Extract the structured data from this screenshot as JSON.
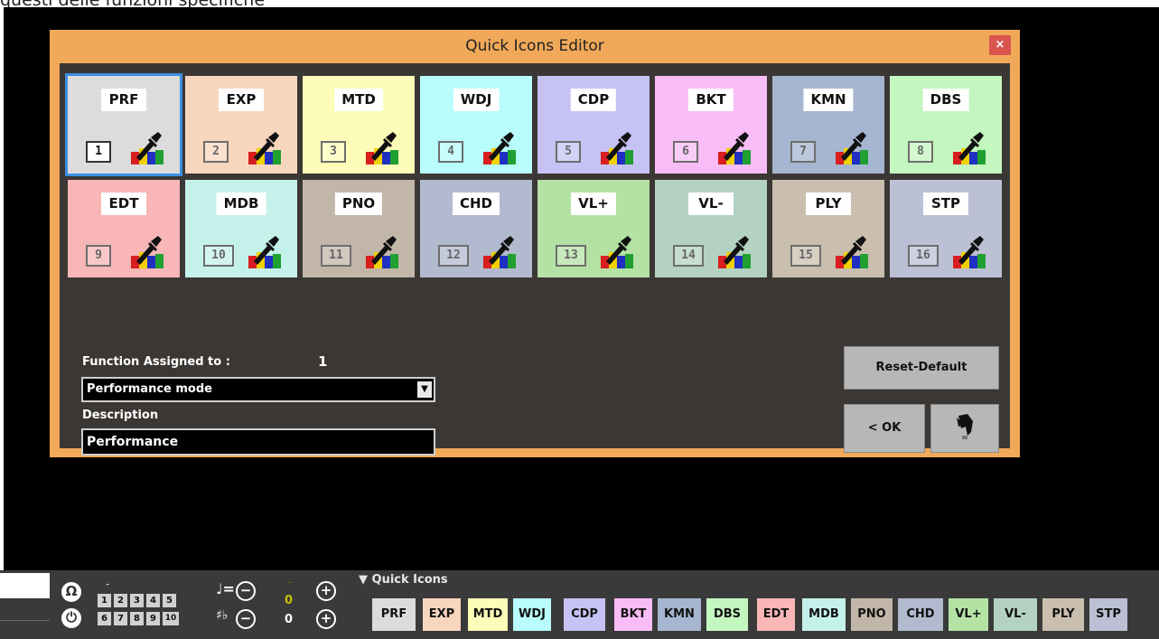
{
  "page_caption": "questi delle funzioni specifiche",
  "dialog": {
    "title": "Quick Icons Editor",
    "close_glyph": "×",
    "tiles": [
      {
        "label": "PRF",
        "number": "1",
        "color": "#dcdcdc"
      },
      {
        "label": "EXP",
        "number": "2",
        "color": "#f8d6be"
      },
      {
        "label": "MTD",
        "number": "3",
        "color": "#fdfcb8"
      },
      {
        "label": "WDJ",
        "number": "4",
        "color": "#b8fcfc"
      },
      {
        "label": "CDP",
        "number": "5",
        "color": "#c6c2f4"
      },
      {
        "label": "BKT",
        "number": "6",
        "color": "#f8bcf6"
      },
      {
        "label": "KMN",
        "number": "7",
        "color": "#a6b6d0"
      },
      {
        "label": "DBS",
        "number": "8",
        "color": "#c4f6c0"
      },
      {
        "label": "EDT",
        "number": "9",
        "color": "#f8b6b6"
      },
      {
        "label": "MDB",
        "number": "10",
        "color": "#c4f2ea"
      },
      {
        "label": "PNO",
        "number": "11",
        "color": "#c2b6a8"
      },
      {
        "label": "CHD",
        "number": "12",
        "color": "#b2bacf"
      },
      {
        "label": "VL+",
        "number": "13",
        "color": "#b4e2a4"
      },
      {
        "label": "VL-",
        "number": "14",
        "color": "#b4d2c2"
      },
      {
        "label": "PLY",
        "number": "15",
        "color": "#cabfae"
      },
      {
        "label": "STP",
        "number": "16",
        "color": "#bcc0d4"
      }
    ],
    "selected_tile": "1",
    "function_assigned_label": "Function Assigned to :",
    "function_assigned_value": "1",
    "function_select": {
      "value": "Performance mode"
    },
    "description_label": "Description",
    "description_value": "Performance",
    "reset_default_label": "Reset-Default",
    "ok_label": "< OK",
    "undo_icon": "undo-arrow-icon"
  },
  "bottombar": {
    "headphone_icon": "Ω",
    "mini_keys_row1": [
      "1",
      "2",
      "3",
      "4",
      "5"
    ],
    "mini_keys_row2": [
      "6",
      "7",
      "8",
      "9",
      "10"
    ],
    "dash1": "-",
    "tempo_symbol": "♩=",
    "transpose_symbol": "♯♭",
    "minus": "−",
    "plus": "+",
    "tempo_value": "0",
    "transpose_value": "0",
    "dash2": "-",
    "quick_icons_header": "▼ Quick Icons",
    "quick_icons": [
      {
        "label": "PRF",
        "color": "#dcdcdc"
      },
      {
        "label": "EXP",
        "color": "#f8d6be"
      },
      {
        "label": "MTD",
        "color": "#fdfcb8"
      },
      {
        "label": "WDJ",
        "color": "#b8fcfc"
      },
      {
        "label": "CDP",
        "color": "#c6c2f4"
      },
      {
        "label": "BKT",
        "color": "#f8bcf6"
      },
      {
        "label": "KMN",
        "color": "#a6b6d0"
      },
      {
        "label": "DBS",
        "color": "#c4f6c0"
      },
      {
        "label": "EDT",
        "color": "#f8b6b6"
      },
      {
        "label": "MDB",
        "color": "#c4f2ea"
      },
      {
        "label": "PNO",
        "color": "#c2b6a8"
      },
      {
        "label": "CHD",
        "color": "#b2bacf"
      },
      {
        "label": "VL+",
        "color": "#b4e2a4"
      },
      {
        "label": "VL-",
        "color": "#b4d2c2"
      },
      {
        "label": "PLY",
        "color": "#cabfae"
      },
      {
        "label": "STP",
        "color": "#bcc0d4"
      }
    ]
  }
}
